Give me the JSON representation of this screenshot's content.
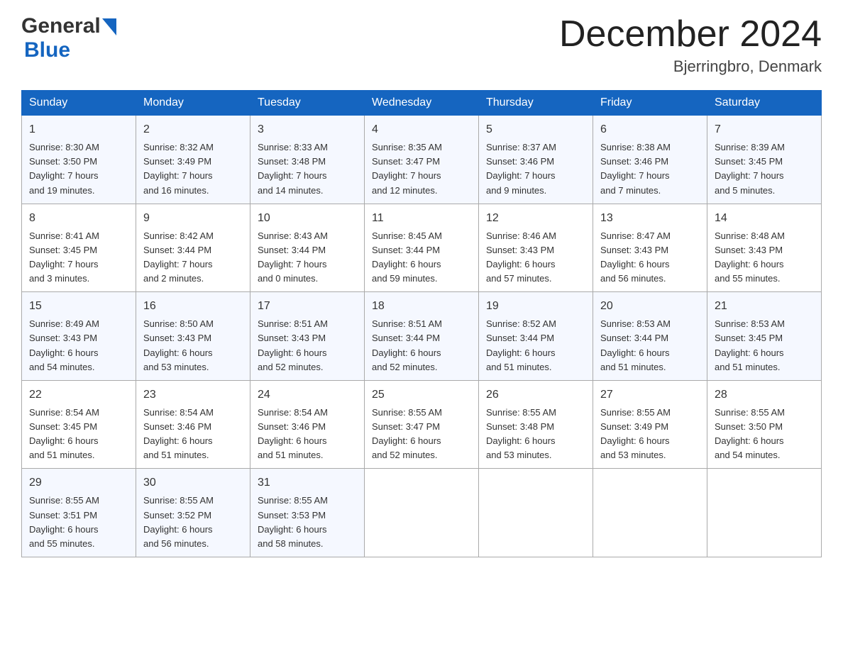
{
  "header": {
    "title": "December 2024",
    "location": "Bjerringbro, Denmark"
  },
  "logo": {
    "general": "General",
    "blue": "Blue"
  },
  "days_of_week": [
    "Sunday",
    "Monday",
    "Tuesday",
    "Wednesday",
    "Thursday",
    "Friday",
    "Saturday"
  ],
  "weeks": [
    [
      {
        "day": "1",
        "sunrise": "8:30 AM",
        "sunset": "3:50 PM",
        "daylight": "7 hours and 19 minutes."
      },
      {
        "day": "2",
        "sunrise": "8:32 AM",
        "sunset": "3:49 PM",
        "daylight": "7 hours and 16 minutes."
      },
      {
        "day": "3",
        "sunrise": "8:33 AM",
        "sunset": "3:48 PM",
        "daylight": "7 hours and 14 minutes."
      },
      {
        "day": "4",
        "sunrise": "8:35 AM",
        "sunset": "3:47 PM",
        "daylight": "7 hours and 12 minutes."
      },
      {
        "day": "5",
        "sunrise": "8:37 AM",
        "sunset": "3:46 PM",
        "daylight": "7 hours and 9 minutes."
      },
      {
        "day": "6",
        "sunrise": "8:38 AM",
        "sunset": "3:46 PM",
        "daylight": "7 hours and 7 minutes."
      },
      {
        "day": "7",
        "sunrise": "8:39 AM",
        "sunset": "3:45 PM",
        "daylight": "7 hours and 5 minutes."
      }
    ],
    [
      {
        "day": "8",
        "sunrise": "8:41 AM",
        "sunset": "3:45 PM",
        "daylight": "7 hours and 3 minutes."
      },
      {
        "day": "9",
        "sunrise": "8:42 AM",
        "sunset": "3:44 PM",
        "daylight": "7 hours and 2 minutes."
      },
      {
        "day": "10",
        "sunrise": "8:43 AM",
        "sunset": "3:44 PM",
        "daylight": "7 hours and 0 minutes."
      },
      {
        "day": "11",
        "sunrise": "8:45 AM",
        "sunset": "3:44 PM",
        "daylight": "6 hours and 59 minutes."
      },
      {
        "day": "12",
        "sunrise": "8:46 AM",
        "sunset": "3:43 PM",
        "daylight": "6 hours and 57 minutes."
      },
      {
        "day": "13",
        "sunrise": "8:47 AM",
        "sunset": "3:43 PM",
        "daylight": "6 hours and 56 minutes."
      },
      {
        "day": "14",
        "sunrise": "8:48 AM",
        "sunset": "3:43 PM",
        "daylight": "6 hours and 55 minutes."
      }
    ],
    [
      {
        "day": "15",
        "sunrise": "8:49 AM",
        "sunset": "3:43 PM",
        "daylight": "6 hours and 54 minutes."
      },
      {
        "day": "16",
        "sunrise": "8:50 AM",
        "sunset": "3:43 PM",
        "daylight": "6 hours and 53 minutes."
      },
      {
        "day": "17",
        "sunrise": "8:51 AM",
        "sunset": "3:43 PM",
        "daylight": "6 hours and 52 minutes."
      },
      {
        "day": "18",
        "sunrise": "8:51 AM",
        "sunset": "3:44 PM",
        "daylight": "6 hours and 52 minutes."
      },
      {
        "day": "19",
        "sunrise": "8:52 AM",
        "sunset": "3:44 PM",
        "daylight": "6 hours and 51 minutes."
      },
      {
        "day": "20",
        "sunrise": "8:53 AM",
        "sunset": "3:44 PM",
        "daylight": "6 hours and 51 minutes."
      },
      {
        "day": "21",
        "sunrise": "8:53 AM",
        "sunset": "3:45 PM",
        "daylight": "6 hours and 51 minutes."
      }
    ],
    [
      {
        "day": "22",
        "sunrise": "8:54 AM",
        "sunset": "3:45 PM",
        "daylight": "6 hours and 51 minutes."
      },
      {
        "day": "23",
        "sunrise": "8:54 AM",
        "sunset": "3:46 PM",
        "daylight": "6 hours and 51 minutes."
      },
      {
        "day": "24",
        "sunrise": "8:54 AM",
        "sunset": "3:46 PM",
        "daylight": "6 hours and 51 minutes."
      },
      {
        "day": "25",
        "sunrise": "8:55 AM",
        "sunset": "3:47 PM",
        "daylight": "6 hours and 52 minutes."
      },
      {
        "day": "26",
        "sunrise": "8:55 AM",
        "sunset": "3:48 PM",
        "daylight": "6 hours and 53 minutes."
      },
      {
        "day": "27",
        "sunrise": "8:55 AM",
        "sunset": "3:49 PM",
        "daylight": "6 hours and 53 minutes."
      },
      {
        "day": "28",
        "sunrise": "8:55 AM",
        "sunset": "3:50 PM",
        "daylight": "6 hours and 54 minutes."
      }
    ],
    [
      {
        "day": "29",
        "sunrise": "8:55 AM",
        "sunset": "3:51 PM",
        "daylight": "6 hours and 55 minutes."
      },
      {
        "day": "30",
        "sunrise": "8:55 AM",
        "sunset": "3:52 PM",
        "daylight": "6 hours and 56 minutes."
      },
      {
        "day": "31",
        "sunrise": "8:55 AM",
        "sunset": "3:53 PM",
        "daylight": "6 hours and 58 minutes."
      },
      null,
      null,
      null,
      null
    ]
  ],
  "labels": {
    "sunrise": "Sunrise:",
    "sunset": "Sunset:",
    "daylight": "Daylight:"
  }
}
